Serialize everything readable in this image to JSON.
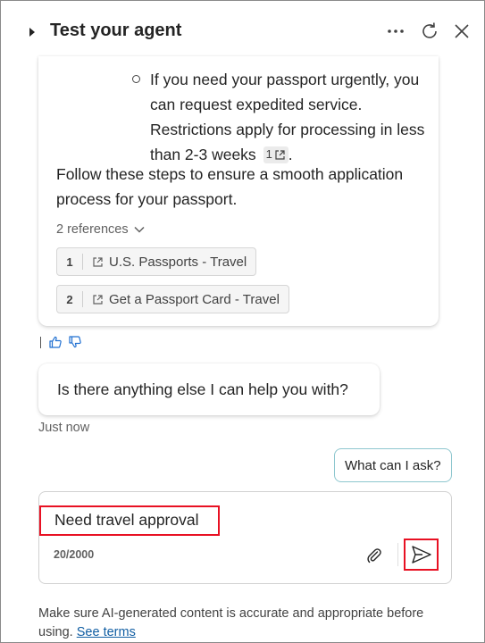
{
  "header": {
    "title": "Test your agent",
    "more_icon": "more-horizontal-icon",
    "refresh_icon": "refresh-icon",
    "close_icon": "close-icon"
  },
  "bot_message": {
    "bullet_text": "If you need your passport urgently, you can request expedited service. Restrictions apply for processing in less than 2-3 weeks",
    "citation_number": "1",
    "bullet_end": ".",
    "followup_text": "Follow these steps to ensure a smooth application process for your passport.",
    "references_toggle": "2 references",
    "references": [
      {
        "number": "1",
        "label": "U.S. Passports - Travel"
      },
      {
        "number": "2",
        "label": "Get a Passport Card - Travel"
      }
    ]
  },
  "feedback": {
    "thumbs_up_icon": "thumbs-up-icon",
    "thumbs_down_icon": "thumbs-down-icon"
  },
  "bot_message_2": {
    "text": "Is there anything else I can help you with?",
    "timestamp": "Just now"
  },
  "suggestion": {
    "label": "What can I ask?"
  },
  "composer": {
    "value": "Need travel approval",
    "char_count": "20/2000",
    "attach_icon": "paperclip-icon",
    "send_icon": "send-icon"
  },
  "disclaimer": {
    "text": "Make sure AI-generated content is accurate and appropriate before using.",
    "link": "See terms"
  },
  "colors": {
    "highlight": "#e81123",
    "link": "#115ea3",
    "chip_border": "#8ec7cf"
  }
}
